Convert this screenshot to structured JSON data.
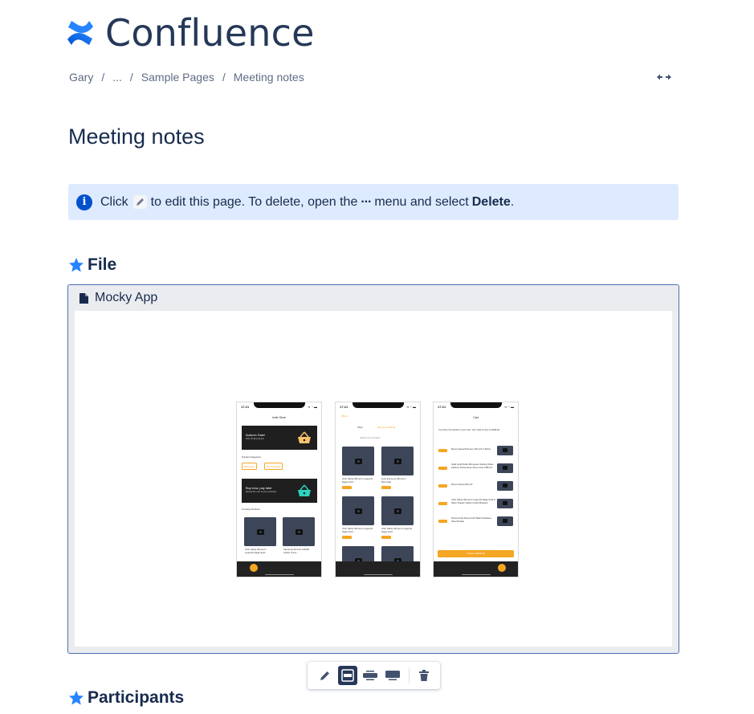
{
  "app": {
    "name": "Confluence",
    "logo_icon": "confluence-logo-icon",
    "brand_color": "#2684ff"
  },
  "breadcrumb": {
    "items": [
      "Gary",
      "...",
      "Sample Pages",
      "Meeting notes"
    ],
    "separator": "/"
  },
  "width_toggle": {
    "icon": "expand-width-icon",
    "glyph": "↔"
  },
  "page": {
    "title": "Meeting notes"
  },
  "info_panel": {
    "icon": "info-icon",
    "text_before": "Click",
    "text_middle": "to edit this page. To delete, open the",
    "ellipsis": "···",
    "text_after": "menu and select",
    "bold": "Delete",
    "period": ".",
    "background": "#deebff"
  },
  "sections": [
    {
      "heading": "File",
      "icon": "star-icon"
    },
    {
      "heading": "Participants",
      "icon": "star-icon"
    }
  ],
  "embed": {
    "file_icon": "document-icon",
    "title": "Mocky App",
    "phones": [
      {
        "time": "17:21",
        "status": "▪▪ ◔ ▬",
        "screen_title": "Indie Store",
        "banner1_title": "Autumn Sale!",
        "banner1_sub": "30% off all products",
        "categories_label": "Popular Categories",
        "chips": [
          "Electronics",
          "Men's Clothing"
        ],
        "banner2_title": "Buy now, pay later",
        "banner2_sub": "Spread the cost of your purchase",
        "trending_label": "Trending Products",
        "products": [
          "John Hardy Women's Legends Naga Gold ...",
          "Samsung 49-Inch CHG90 144Hz Curve..."
        ]
      },
      {
        "time": "17:21",
        "status": "▪▪ ◔ ▬",
        "back": "< Back",
        "filter_label": "Shop",
        "filter_value": "Women's clothing",
        "search_placeholder": "Search for a product",
        "products": [
          "John Hardy Women's Legends Naga Gold ...",
          "Lock and Love Women's Removab...",
          "John Hardy Women's Legends Naga Gold ...",
          "John Hardy Women's Legends Naga Gold ..."
        ]
      },
      {
        "time": "17:21",
        "status": "▪▪ ◔ ▬",
        "screen_title": "Cart",
        "summary": "You have 5 products in your cart. Your total comes to $168.24",
        "items": [
          "Mens Casual Premium Slim Fit T-Shirts",
          "Solid Gold Petite Micropave Sterling Silver Fashion Perfomance Pure Level USB 3.0",
          "Mens Casual Slim Fit",
          "John Hardy Women's Legends Naga Gold & Silver Dragon Station Chain Bracelet",
          "Pierced Owl Rose Gold Plated Stainless Steel Double"
        ],
        "checkout_label": "Checkout ($168.24)"
      }
    ]
  },
  "toolbar": {
    "buttons": [
      {
        "name": "edit-button",
        "icon": "pencil-icon",
        "active": false
      },
      {
        "name": "layout-inline-button",
        "icon": "layout-inline-icon",
        "active": true
      },
      {
        "name": "layout-wide-button",
        "icon": "layout-wide-icon",
        "active": false
      },
      {
        "name": "layout-full-width-button",
        "icon": "layout-full-width-icon",
        "active": false
      },
      {
        "name": "delete-button",
        "icon": "trash-icon",
        "active": false
      }
    ],
    "active_color": "#253858"
  }
}
